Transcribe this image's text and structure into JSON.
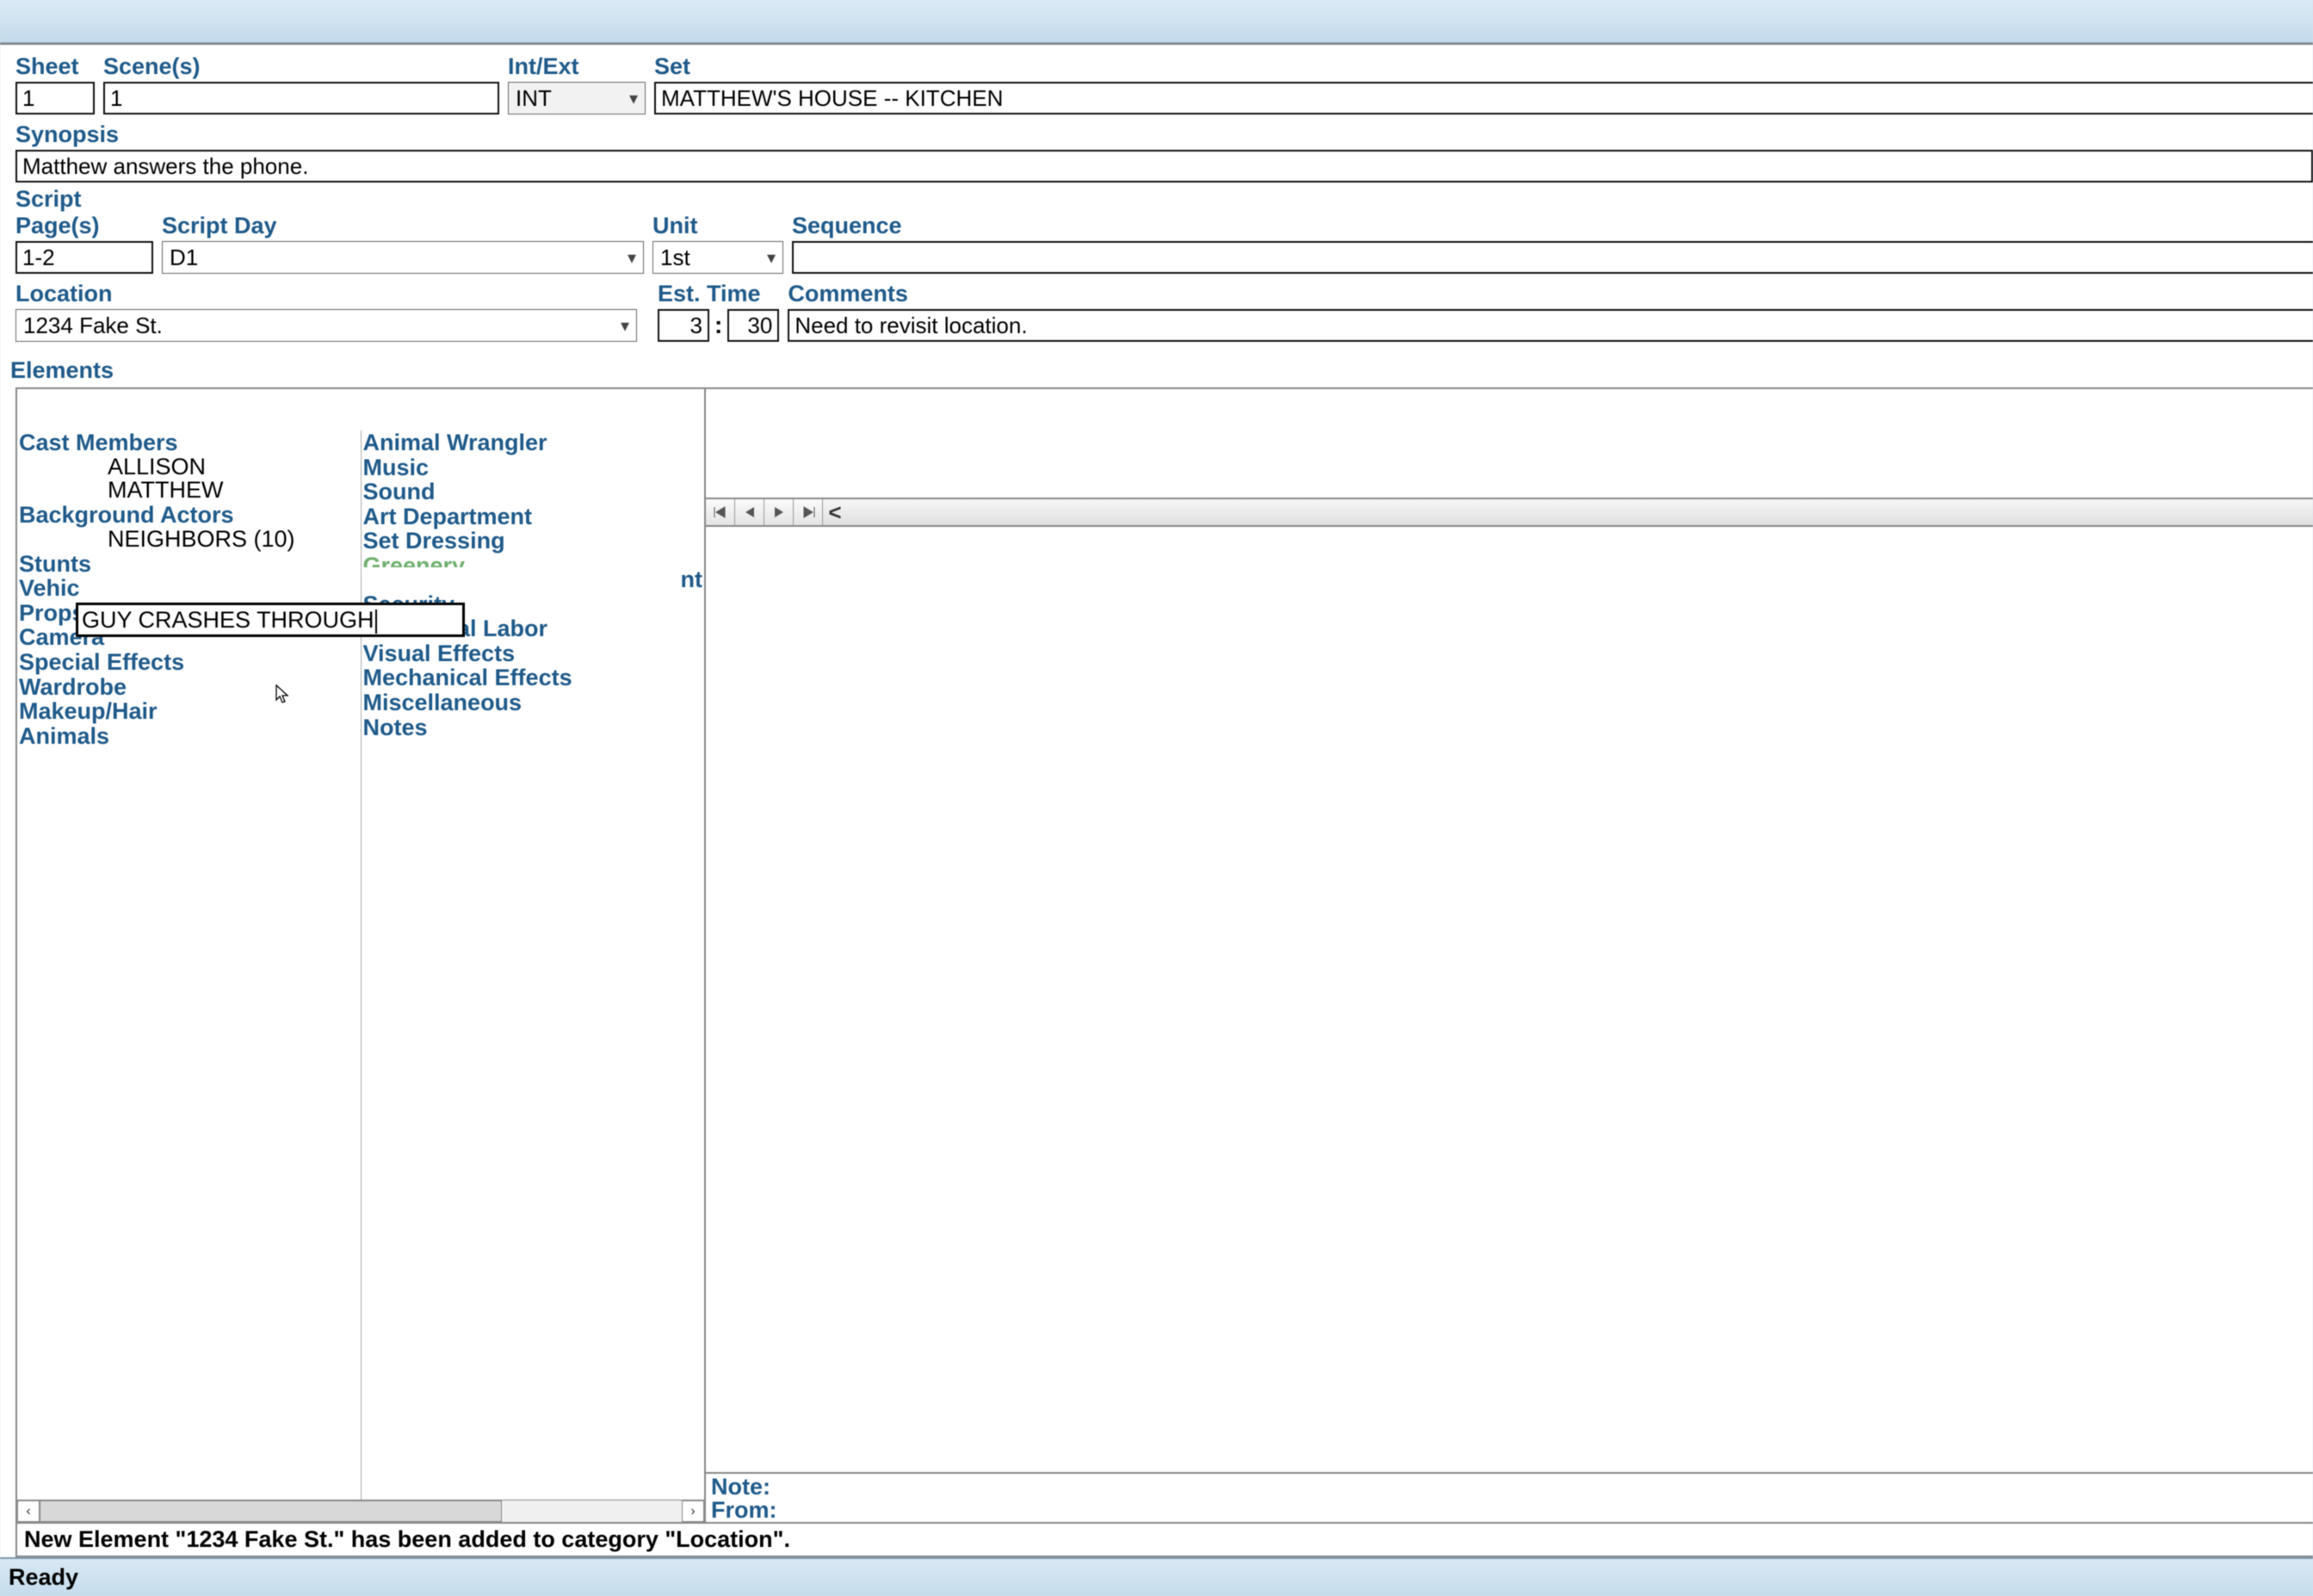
{
  "labels": {
    "sheet": "Sheet",
    "scenes": "Scene(s)",
    "intext": "Int/Ext",
    "set": "Set",
    "synopsis": "Synopsis",
    "script_pages": "Script Page(s)",
    "script_day": "Script Day",
    "unit": "Unit",
    "sequence": "Sequence",
    "location": "Location",
    "est_time": "Est. Time",
    "comments": "Comments",
    "elements": "Elements",
    "note": "Note:",
    "from": "From:"
  },
  "values": {
    "sheet": "1",
    "scenes": "1",
    "intext": "INT",
    "set": "MATTHEW'S HOUSE -- KITCHEN",
    "synopsis": "Matthew answers the phone.",
    "script_pages": "1-2",
    "script_day": "D1",
    "unit": "1st",
    "sequence": "",
    "location": "1234 Fake St.",
    "est_time_h": "3",
    "est_time_m": "30",
    "comments": "Need to revisit location.",
    "stunt_editor": "GUY CRASHES THROUGH"
  },
  "categories_col1": [
    {
      "header": "Cast Members",
      "items": [
        "ALLISON",
        "MATTHEW"
      ]
    },
    {
      "header": "Background Actors",
      "items": [
        "NEIGHBORS (10)"
      ]
    },
    {
      "header": "Stunts",
      "items": []
    },
    {
      "header": "Vehic",
      "items": []
    },
    {
      "header": "Props",
      "items": []
    },
    {
      "header": "Camera",
      "items": []
    },
    {
      "header": "Special Effects",
      "items": []
    },
    {
      "header": "Wardrobe",
      "items": []
    },
    {
      "header": "Makeup/Hair",
      "items": []
    },
    {
      "header": "Animals",
      "items": []
    }
  ],
  "categories_col2": [
    {
      "header": "Animal Wrangler",
      "items": []
    },
    {
      "header": "Music",
      "items": []
    },
    {
      "header": "Sound",
      "items": []
    },
    {
      "header": "Art Department",
      "items": []
    },
    {
      "header": "Set Dressing",
      "items": []
    },
    {
      "header": "Greenery",
      "items": [],
      "cut": true
    },
    {
      "header_suffix": "nt"
    },
    {
      "header": "Security",
      "items": []
    },
    {
      "header": "Additional Labor",
      "items": []
    },
    {
      "header": "Visual Effects",
      "items": []
    },
    {
      "header": "Mechanical Effects",
      "items": []
    },
    {
      "header": "Miscellaneous",
      "items": []
    },
    {
      "header": "Notes",
      "items": []
    }
  ],
  "message_bar": "New Element \"1234 Fake St.\" has been added to category \"Location\".",
  "status_bar": "Ready"
}
